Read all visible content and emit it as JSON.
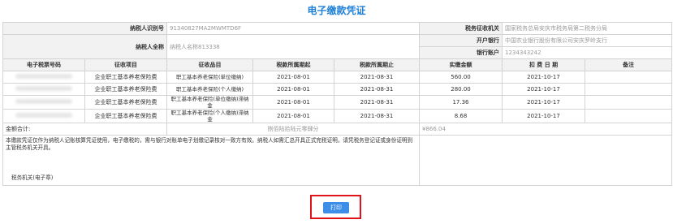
{
  "title": "电子缴款凭证",
  "taxpayer_id_label": "纳税人识别号",
  "taxpayer_id_value": "91340827MA2MWMTD6F",
  "tax_authority_label": "税务征收机关",
  "tax_authority_value": "国家税务总局安庆市税务局第二税务分局",
  "taxpayer_name_label": "纳税人全称",
  "taxpayer_name_value": "纳税人名称813338",
  "bank_label": "开户银行",
  "bank_value": "中国农业银行股份有限公司安庆罗岭支行",
  "bank_account_label": "银行账户",
  "bank_account_value": "1234343242",
  "columns": [
    "电子税票号码",
    "征收项目",
    "征收品目",
    "税款所属期起",
    "税款所属期止",
    "实缴金额",
    "扣 费 日 期",
    "备注"
  ],
  "rows": [
    {
      "item": "企业职工基本养老保险费",
      "subitem": "职工基本养老保险(单位缴纳)",
      "start": "2021-08-01",
      "end": "2021-08-31",
      "amount": "560.00",
      "date": "2021-10-17",
      "note": ""
    },
    {
      "item": "企业职工基本养老保险费",
      "subitem": "职工基本养老保险(个人缴纳)",
      "start": "2021-08-01",
      "end": "2021-08-31",
      "amount": "280.00",
      "date": "2021-10-17",
      "note": ""
    },
    {
      "item": "企业职工基本养老保险费",
      "subitem": "职工基本养老保险(单位缴纳)滞纳金",
      "start": "2021-08-01",
      "end": "2021-08-31",
      "amount": "17.36",
      "date": "2021-10-17",
      "note": ""
    },
    {
      "item": "企业职工基本养老保险费",
      "subitem": "职工基本养老保险(个人缴纳)滞纳金",
      "start": "2021-08-01",
      "end": "2021-08-31",
      "amount": "8.68",
      "date": "2021-10-17",
      "note": ""
    }
  ],
  "total_label": "金额合计:",
  "total_words": "捌佰陆拾陆元零肆分",
  "total_amount": "¥866.04",
  "notice_text": "本缴款凭证仅作为纳税人记账核算凭证使用，电子缴税的，需与银行对账单电子划缴记录核对一致方有效。纳税人如需汇总开具正式完税证明，请凭税务登记证或身份证明到主管税务机关开具。",
  "tax_office_seal": "税务机关(电子章)",
  "print_label": "打印",
  "colors": {
    "title": "#1e7fd6",
    "button": "#3d8ee8",
    "highlight": "#e0131a"
  }
}
